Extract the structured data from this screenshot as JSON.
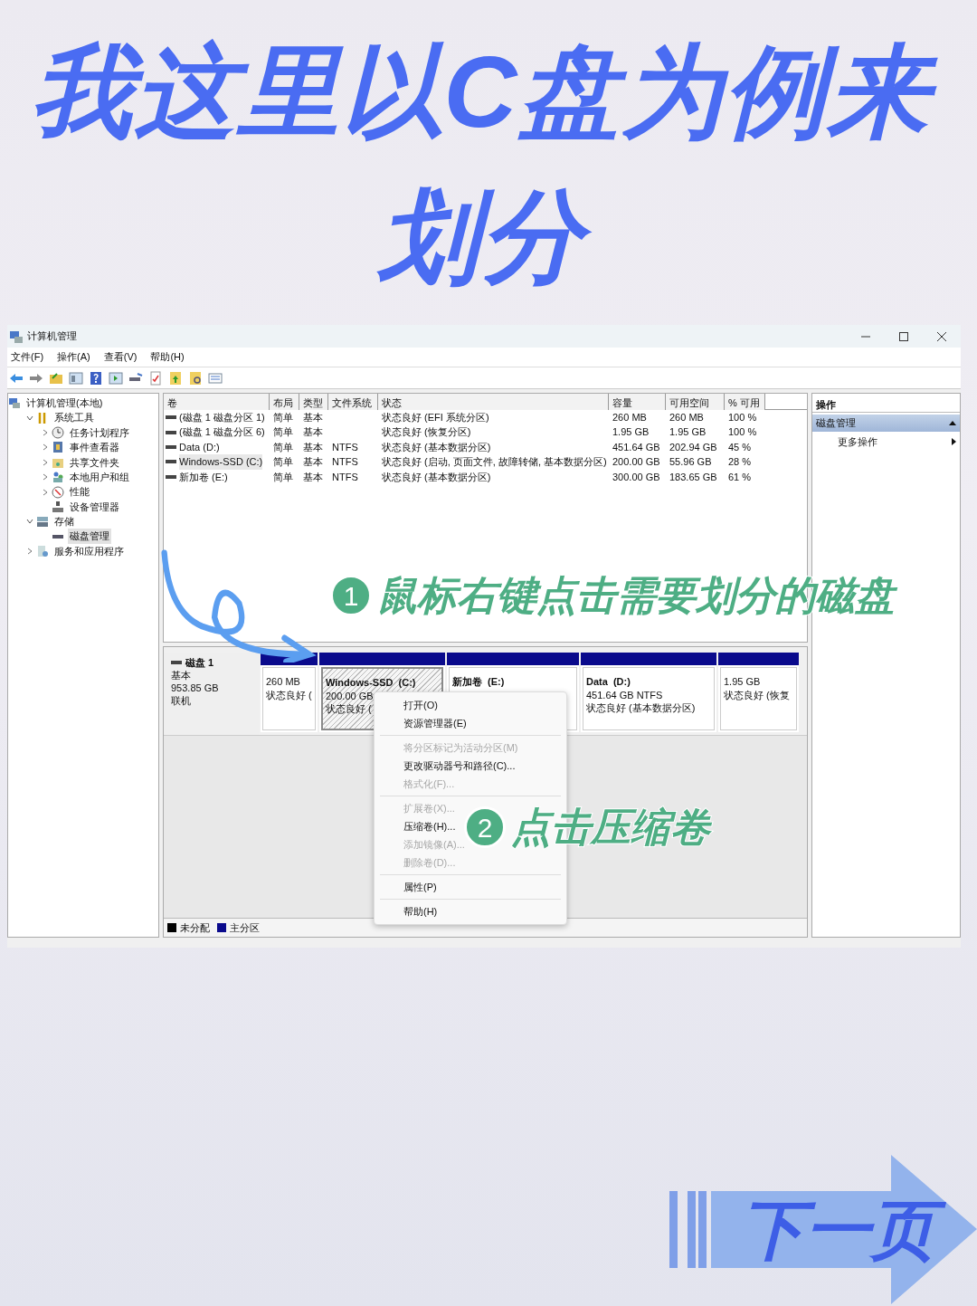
{
  "title_lines": [
    "我这里以C盘为例来",
    "划分"
  ],
  "window": {
    "title": "计算机管理"
  },
  "menu_bar": [
    "文件(F)",
    "操作(A)",
    "查看(V)",
    "帮助(H)"
  ],
  "tree": [
    {
      "label": "计算机管理(本地)",
      "selected": false,
      "children": [
        {
          "label": "系统工具",
          "expanded": true,
          "selected": false,
          "children": [
            {
              "label": "任务计划程序",
              "expanded": false,
              "selected": false
            },
            {
              "label": "事件查看器",
              "expanded": false,
              "selected": false
            },
            {
              "label": "共享文件夹",
              "expanded": false,
              "selected": false
            },
            {
              "label": "本地用户和组",
              "expanded": false,
              "selected": false
            },
            {
              "label": "性能",
              "expanded": false,
              "selected": false
            },
            {
              "label": "设备管理器",
              "selected": false
            }
          ]
        },
        {
          "label": "存储",
          "expanded": true,
          "selected": false,
          "children": [
            {
              "label": "磁盘管理",
              "selected": true
            }
          ]
        },
        {
          "label": "服务和应用程序",
          "expanded": false,
          "selected": false
        }
      ]
    }
  ],
  "table": {
    "columns": [
      "卷",
      "布局",
      "类型",
      "文件系统",
      "状态",
      "容量",
      "可用空间",
      "% 可用"
    ],
    "rows": [
      {
        "selected": false,
        "cells": [
          "(磁盘 1 磁盘分区 1)",
          "简单",
          "基本",
          "",
          "状态良好 (EFI 系统分区)",
          "260 MB",
          "260 MB",
          "100 %"
        ]
      },
      {
        "selected": false,
        "cells": [
          "(磁盘 1 磁盘分区 6)",
          "简单",
          "基本",
          "",
          "状态良好 (恢复分区)",
          "1.95 GB",
          "1.95 GB",
          "100 %"
        ]
      },
      {
        "selected": false,
        "cells": [
          "Data (D:)",
          "简单",
          "基本",
          "NTFS",
          "状态良好 (基本数据分区)",
          "451.64 GB",
          "202.94 GB",
          "45 %"
        ]
      },
      {
        "selected": true,
        "cells": [
          "Windows-SSD (C:)",
          "简单",
          "基本",
          "NTFS",
          "状态良好 (启动, 页面文件, 故障转储, 基本数据分区)",
          "200.00 GB",
          "55.96 GB",
          "28 %"
        ]
      },
      {
        "selected": false,
        "cells": [
          "新加卷 (E:)",
          "简单",
          "基本",
          "NTFS",
          "状态良好 (基本数据分区)",
          "300.00 GB",
          "183.65 GB",
          "61 %"
        ]
      }
    ]
  },
  "disk": {
    "name": "磁盘 1",
    "type": "基本",
    "size": "953.85 GB",
    "status": "联机",
    "partitions": [
      {
        "selected": false,
        "lines": [
          "260 MB",
          "状态良好 ("
        ]
      },
      {
        "selected": true,
        "title": "Windows-SSD  (C:)",
        "lines": [
          "200.00 GB",
          "状态良好 ("
        ]
      },
      {
        "selected": false,
        "title": "新加卷  (E:)"
      },
      {
        "selected": false,
        "title": "Data  (D:)",
        "lines": [
          "451.64 GB NTFS",
          "状态良好 (基本数据分区)"
        ]
      },
      {
        "selected": false,
        "lines": [
          "1.95 GB",
          "状态良好 (恢复"
        ]
      }
    ]
  },
  "legend": [
    {
      "label": "未分配",
      "color": "#000000"
    },
    {
      "label": "主分区",
      "color": "#0a0a8c"
    }
  ],
  "actions": {
    "header": "操作",
    "section": "磁盘管理",
    "items": [
      "更多操作"
    ]
  },
  "context_menu": [
    {
      "kind": "item",
      "label": "打开(O)",
      "disabled": false
    },
    {
      "kind": "item",
      "label": "资源管理器(E)",
      "disabled": false
    },
    {
      "kind": "separator"
    },
    {
      "kind": "item",
      "label": "将分区标记为活动分区(M)",
      "disabled": true
    },
    {
      "kind": "item",
      "label": "更改驱动器号和路径(C)...",
      "disabled": false
    },
    {
      "kind": "item",
      "label": "格式化(F)...",
      "disabled": true
    },
    {
      "kind": "separator"
    },
    {
      "kind": "item",
      "label": "扩展卷(X)...",
      "disabled": true
    },
    {
      "kind": "item",
      "label": "压缩卷(H)...",
      "disabled": false
    },
    {
      "kind": "item",
      "label": "添加镜像(A)...",
      "disabled": true
    },
    {
      "kind": "item",
      "label": "删除卷(D)...",
      "disabled": true
    },
    {
      "kind": "separator"
    },
    {
      "kind": "item",
      "label": "属性(P)",
      "disabled": false
    },
    {
      "kind": "separator"
    },
    {
      "kind": "item",
      "label": "帮助(H)",
      "disabled": false
    }
  ],
  "annotations": [
    {
      "number": "1",
      "text": "鼠标右键点击需要划分的磁盘"
    },
    {
      "number": "2",
      "text": "点击压缩卷"
    }
  ],
  "next_button": "下一页"
}
